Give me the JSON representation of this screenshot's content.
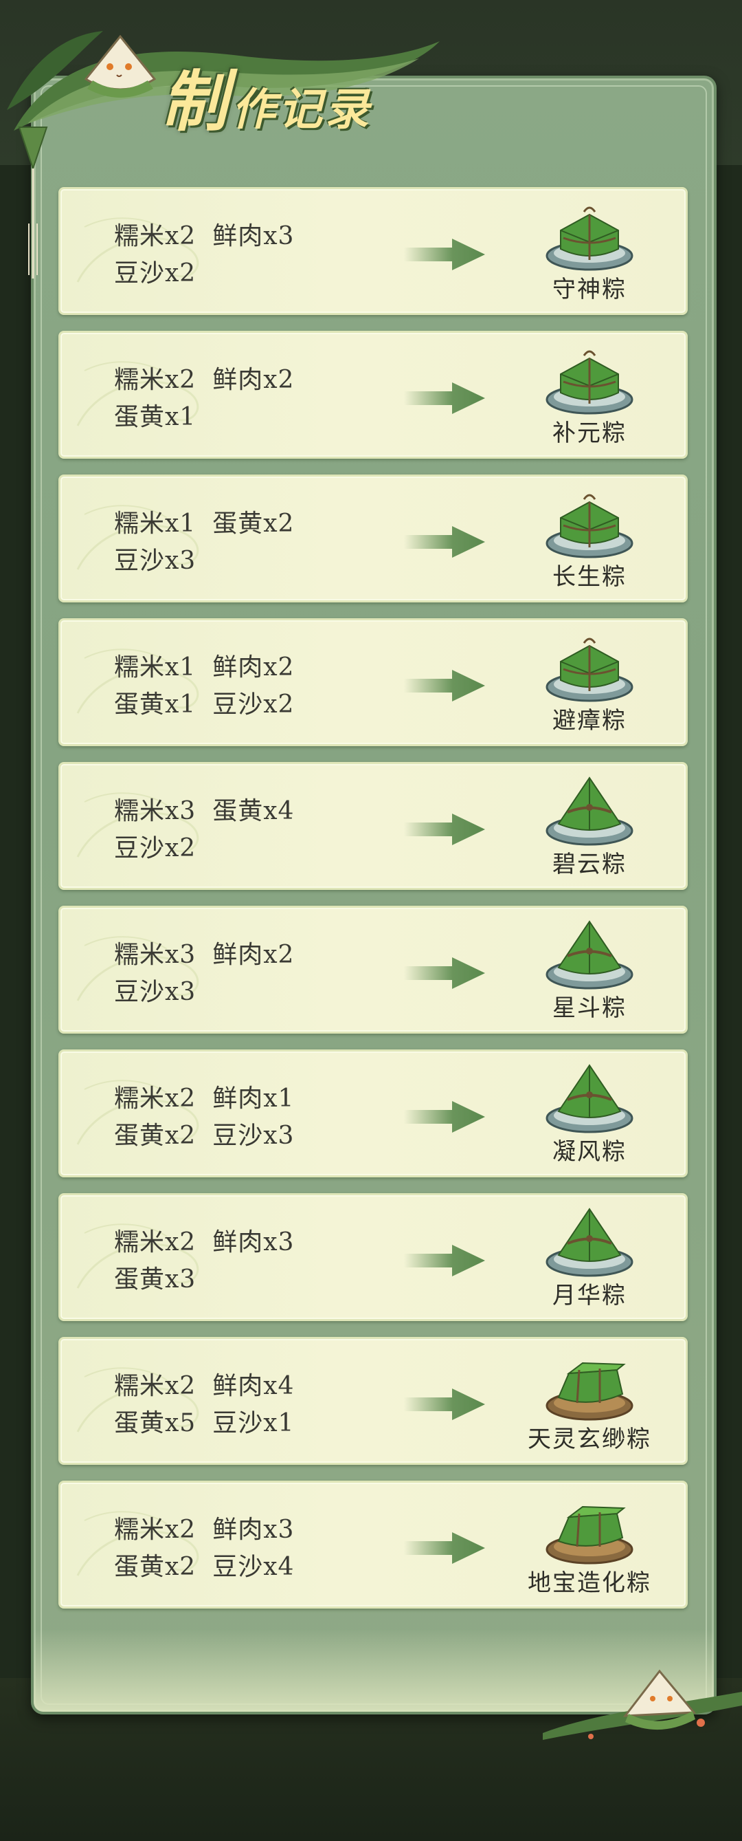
{
  "header": {
    "title_main": "制",
    "title_rest": "作记录"
  },
  "records": [
    {
      "line1": [
        "糯米x2",
        "鲜肉x3"
      ],
      "line2": [
        "豆沙x2"
      ],
      "result": "守神粽",
      "style": "square"
    },
    {
      "line1": [
        "糯米x2",
        "鲜肉x2"
      ],
      "line2": [
        "蛋黄x1"
      ],
      "result": "补元粽",
      "style": "square"
    },
    {
      "line1": [
        "糯米x1",
        "蛋黄x2"
      ],
      "line2": [
        "豆沙x3"
      ],
      "result": "长生粽",
      "style": "square"
    },
    {
      "line1": [
        "糯米x1",
        "鲜肉x2"
      ],
      "line2": [
        "蛋黄x1",
        "豆沙x2"
      ],
      "result": "避瘴粽",
      "style": "square"
    },
    {
      "line1": [
        "糯米x3",
        "蛋黄x4"
      ],
      "line2": [
        "豆沙x2"
      ],
      "result": "碧云粽",
      "style": "pyramid"
    },
    {
      "line1": [
        "糯米x3",
        "鲜肉x2"
      ],
      "line2": [
        "豆沙x3"
      ],
      "result": "星斗粽",
      "style": "pyramid"
    },
    {
      "line1": [
        "糯米x2",
        "鲜肉x1"
      ],
      "line2": [
        "蛋黄x2",
        "豆沙x3"
      ],
      "result": "凝风粽",
      "style": "pyramid"
    },
    {
      "line1": [
        "糯米x2",
        "鲜肉x3"
      ],
      "line2": [
        "蛋黄x3"
      ],
      "result": "月华粽",
      "style": "pyramid"
    },
    {
      "line1": [
        "糯米x2",
        "鲜肉x4"
      ],
      "line2": [
        "蛋黄x5",
        "豆沙x1"
      ],
      "result": "天灵玄缈粽",
      "style": "long"
    },
    {
      "line1": [
        "糯米x2",
        "鲜肉x3"
      ],
      "line2": [
        "蛋黄x2",
        "豆沙x4"
      ],
      "result": "地宝造化粽",
      "style": "long"
    }
  ],
  "colors": {
    "panel": "#8ba886",
    "card": "#f1f2d2",
    "arrow": "#5b8a4e",
    "title": "#fbe89a",
    "text": "#3a3a34"
  },
  "icons": {
    "arrow": "right-arrow-icon",
    "mascot": "zongzi-mascot-icon",
    "dish_square": "square-zongzi-plate-icon",
    "dish_pyramid": "pyramid-zongzi-plate-icon",
    "dish_long": "long-zongzi-plate-icon"
  }
}
